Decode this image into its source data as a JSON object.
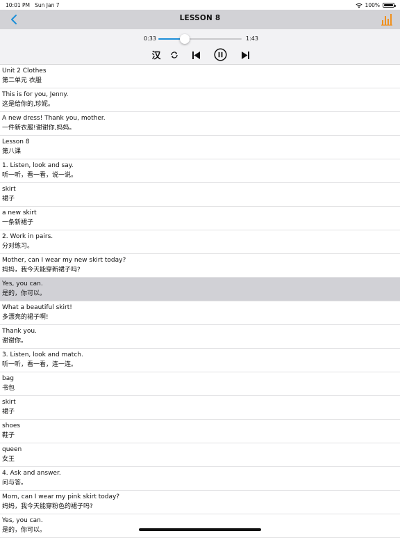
{
  "status": {
    "time": "10:01 PM",
    "date": "Sun Jan 7",
    "battery": "100%",
    "battery_level": 1.0
  },
  "nav": {
    "title": "LESSON 8",
    "back_icon": "chevron-left-icon",
    "menu_icon": "audio-bars-icon",
    "accent": "#f0901c"
  },
  "player": {
    "current": "0:33",
    "total": "1:43",
    "progress": 0.32,
    "accent": "#1d8fd8",
    "han_label": "汉"
  },
  "rows": [
    {
      "en": "Unit 2 Clothes",
      "zh": "第二单元 衣服"
    },
    {
      "en": "This is for you, Jenny.",
      "zh": "这是给你的,珍妮。"
    },
    {
      "en": "A new dress! Thank you, mother.",
      "zh": "一件新衣服!谢谢你,妈妈。"
    },
    {
      "en": "Lesson 8",
      "zh": "第八课"
    },
    {
      "en": "1. Listen, look and say.",
      "zh": "听一听，看一看，说一说。"
    },
    {
      "en": "skirt",
      "zh": "裙子"
    },
    {
      "en": "a new skirt",
      "zh": "一条新裙子"
    },
    {
      "en": "2. Work in pairs.",
      "zh": "分对练习。"
    },
    {
      "en": "Mother, can I wear my new skirt today?",
      "zh": "妈妈，我今天能穿新裙子吗?"
    },
    {
      "en": "Yes, you can.",
      "zh": "是的，你可以。",
      "selected": true
    },
    {
      "en": "What a beautiful skirt!",
      "zh": "多漂亮的裙子啊!"
    },
    {
      "en": "Thank you.",
      "zh": "谢谢你。"
    },
    {
      "en": "3. Listen, look and match.",
      "zh": "听一听，看一看，连一连。"
    },
    {
      "en": "bag",
      "zh": "书包"
    },
    {
      "en": "skirt",
      "zh": "裙子"
    },
    {
      "en": "shoes",
      "zh": "鞋子"
    },
    {
      "en": "queen",
      "zh": "女王"
    },
    {
      "en": "4. Ask and answer.",
      "zh": "问与答。"
    },
    {
      "en": "Mom, can I wear my pink skirt today?",
      "zh": "妈妈，我今天能穿粉色的裙子吗?"
    },
    {
      "en": "Yes, you can.",
      "zh": "是的，你可以。"
    }
  ]
}
